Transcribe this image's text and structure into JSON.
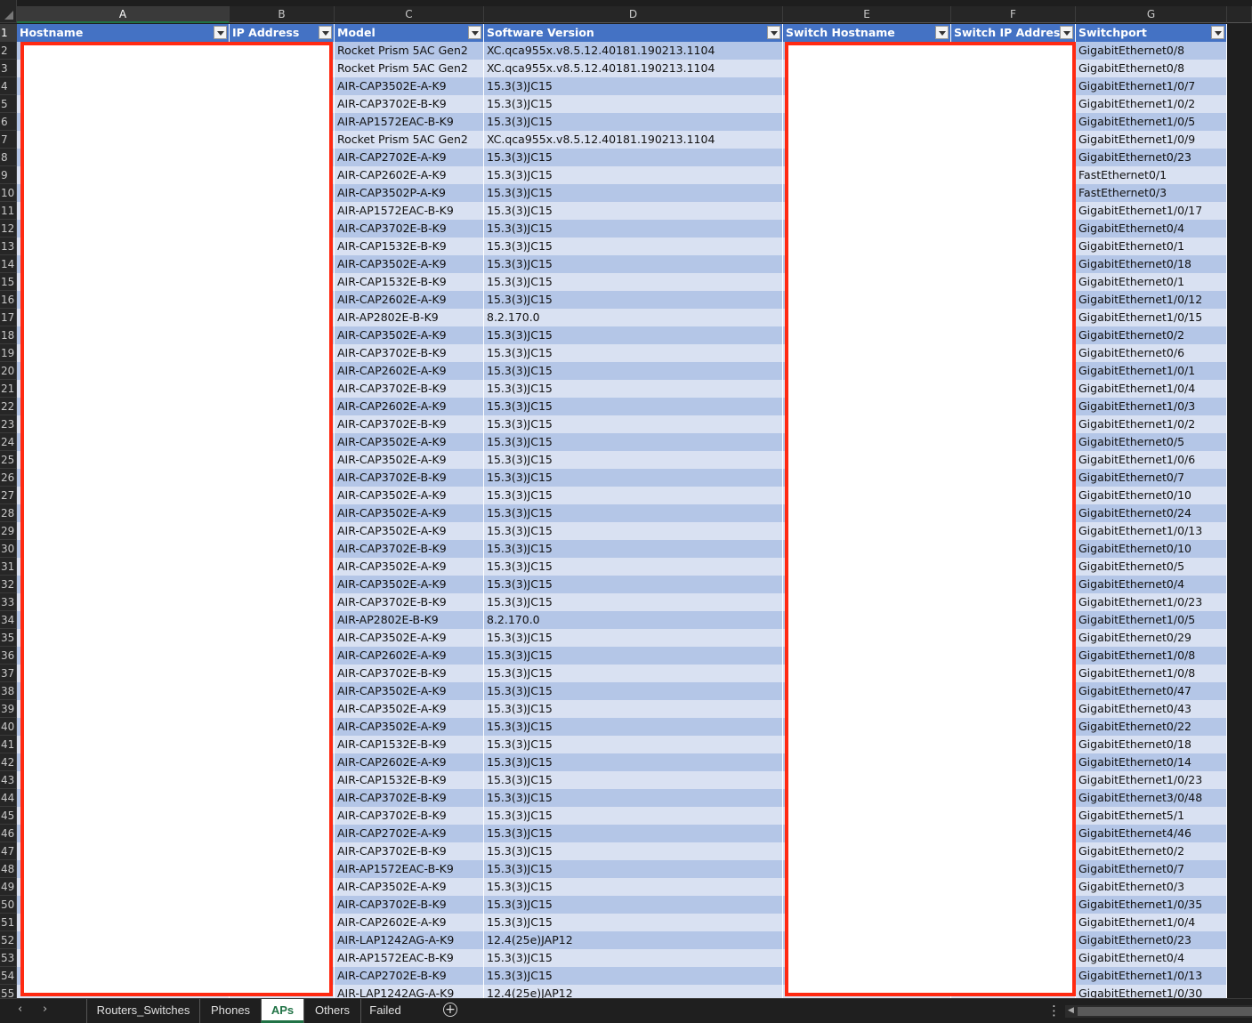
{
  "column_letters": [
    "A",
    "B",
    "C",
    "D",
    "E",
    "F",
    "G"
  ],
  "headers": [
    "Hostname",
    "IP Address",
    "Model",
    "Software Version",
    "Switch Hostname",
    "Switch IP Address",
    "Switchport"
  ],
  "row_numbers": [
    1,
    2,
    3,
    4,
    5,
    6,
    7,
    8,
    9,
    10,
    11,
    12,
    13,
    14,
    15,
    16,
    17,
    18,
    19,
    20,
    21,
    22,
    23,
    24,
    25,
    26,
    27,
    28,
    29,
    30,
    31,
    32,
    33,
    34,
    35,
    36,
    37,
    38,
    39,
    40,
    41,
    42,
    43,
    44,
    45,
    46,
    47,
    48,
    49,
    50,
    51,
    52,
    53,
    54,
    55
  ],
  "rows": [
    {
      "model": "Rocket Prism 5AC Gen2",
      "version": "XC.qca955x.v8.5.12.40181.190213.1104",
      "port": "GigabitEthernet0/8"
    },
    {
      "model": "Rocket Prism 5AC Gen2",
      "version": "XC.qca955x.v8.5.12.40181.190213.1104",
      "port": "GigabitEthernet0/8"
    },
    {
      "model": "AIR-CAP3502E-A-K9",
      "version": "15.3(3)JC15",
      "port": "GigabitEthernet1/0/7"
    },
    {
      "model": "AIR-CAP3702E-B-K9",
      "version": "15.3(3)JC15",
      "port": "GigabitEthernet1/0/2"
    },
    {
      "model": "AIR-AP1572EAC-B-K9",
      "version": "15.3(3)JC15",
      "port": "GigabitEthernet1/0/5"
    },
    {
      "model": "Rocket Prism 5AC Gen2",
      "version": "XC.qca955x.v8.5.12.40181.190213.1104",
      "port": "GigabitEthernet1/0/9"
    },
    {
      "model": "AIR-CAP2702E-A-K9",
      "version": "15.3(3)JC15",
      "port": "GigabitEthernet0/23"
    },
    {
      "model": "AIR-CAP2602E-A-K9",
      "version": "15.3(3)JC15",
      "port": "FastEthernet0/1"
    },
    {
      "model": "AIR-CAP3502P-A-K9",
      "version": "15.3(3)JC15",
      "port": "FastEthernet0/3"
    },
    {
      "model": "AIR-AP1572EAC-B-K9",
      "version": "15.3(3)JC15",
      "port": "GigabitEthernet1/0/17"
    },
    {
      "model": "AIR-CAP3702E-B-K9",
      "version": "15.3(3)JC15",
      "port": "GigabitEthernet0/4"
    },
    {
      "model": "AIR-CAP1532E-B-K9",
      "version": "15.3(3)JC15",
      "port": "GigabitEthernet0/1"
    },
    {
      "model": "AIR-CAP3502E-A-K9",
      "version": "15.3(3)JC15",
      "port": "GigabitEthernet0/18"
    },
    {
      "model": "AIR-CAP1532E-B-K9",
      "version": "15.3(3)JC15",
      "port": "GigabitEthernet0/1"
    },
    {
      "model": "AIR-CAP2602E-A-K9",
      "version": "15.3(3)JC15",
      "port": "GigabitEthernet1/0/12"
    },
    {
      "model": "AIR-AP2802E-B-K9",
      "version": "8.2.170.0",
      "port": "GigabitEthernet1/0/15"
    },
    {
      "model": "AIR-CAP3502E-A-K9",
      "version": "15.3(3)JC15",
      "port": "GigabitEthernet0/2"
    },
    {
      "model": "AIR-CAP3702E-B-K9",
      "version": "15.3(3)JC15",
      "port": "GigabitEthernet0/6"
    },
    {
      "model": "AIR-CAP2602E-A-K9",
      "version": "15.3(3)JC15",
      "port": "GigabitEthernet1/0/1"
    },
    {
      "model": "AIR-CAP3702E-B-K9",
      "version": "15.3(3)JC15",
      "port": "GigabitEthernet1/0/4"
    },
    {
      "model": "AIR-CAP2602E-A-K9",
      "version": "15.3(3)JC15",
      "port": "GigabitEthernet1/0/3"
    },
    {
      "model": "AIR-CAP3702E-B-K9",
      "version": "15.3(3)JC15",
      "port": "GigabitEthernet1/0/2"
    },
    {
      "model": "AIR-CAP3502E-A-K9",
      "version": "15.3(3)JC15",
      "port": "GigabitEthernet0/5"
    },
    {
      "model": "AIR-CAP3502E-A-K9",
      "version": "15.3(3)JC15",
      "port": "GigabitEthernet1/0/6"
    },
    {
      "model": "AIR-CAP3702E-B-K9",
      "version": "15.3(3)JC15",
      "port": "GigabitEthernet0/7"
    },
    {
      "model": "AIR-CAP3502E-A-K9",
      "version": "15.3(3)JC15",
      "port": "GigabitEthernet0/10"
    },
    {
      "model": "AIR-CAP3502E-A-K9",
      "version": "15.3(3)JC15",
      "port": "GigabitEthernet0/24"
    },
    {
      "model": "AIR-CAP3502E-A-K9",
      "version": "15.3(3)JC15",
      "port": "GigabitEthernet1/0/13"
    },
    {
      "model": "AIR-CAP3702E-B-K9",
      "version": "15.3(3)JC15",
      "port": "GigabitEthernet0/10"
    },
    {
      "model": "AIR-CAP3502E-A-K9",
      "version": "15.3(3)JC15",
      "port": "GigabitEthernet0/5"
    },
    {
      "model": "AIR-CAP3502E-A-K9",
      "version": "15.3(3)JC15",
      "port": "GigabitEthernet0/4"
    },
    {
      "model": "AIR-CAP3702E-B-K9",
      "version": "15.3(3)JC15",
      "port": "GigabitEthernet1/0/23"
    },
    {
      "model": "AIR-AP2802E-B-K9",
      "version": "8.2.170.0",
      "port": "GigabitEthernet1/0/5"
    },
    {
      "model": "AIR-CAP3502E-A-K9",
      "version": "15.3(3)JC15",
      "port": "GigabitEthernet0/29"
    },
    {
      "model": "AIR-CAP2602E-A-K9",
      "version": "15.3(3)JC15",
      "port": "GigabitEthernet1/0/8"
    },
    {
      "model": "AIR-CAP3702E-B-K9",
      "version": "15.3(3)JC15",
      "port": "GigabitEthernet1/0/8"
    },
    {
      "model": "AIR-CAP3502E-A-K9",
      "version": "15.3(3)JC15",
      "port": "GigabitEthernet0/47"
    },
    {
      "model": "AIR-CAP3502E-A-K9",
      "version": "15.3(3)JC15",
      "port": "GigabitEthernet0/43"
    },
    {
      "model": "AIR-CAP3502E-A-K9",
      "version": "15.3(3)JC15",
      "port": "GigabitEthernet0/22"
    },
    {
      "model": "AIR-CAP1532E-B-K9",
      "version": "15.3(3)JC15",
      "port": "GigabitEthernet0/18"
    },
    {
      "model": "AIR-CAP2602E-A-K9",
      "version": "15.3(3)JC15",
      "port": "GigabitEthernet0/14"
    },
    {
      "model": "AIR-CAP1532E-B-K9",
      "version": "15.3(3)JC15",
      "port": "GigabitEthernet1/0/23"
    },
    {
      "model": "AIR-CAP3702E-B-K9",
      "version": "15.3(3)JC15",
      "port": "GigabitEthernet3/0/48"
    },
    {
      "model": "AIR-CAP3702E-B-K9",
      "version": "15.3(3)JC15",
      "port": "GigabitEthernet5/1"
    },
    {
      "model": "AIR-CAP2702E-A-K9",
      "version": "15.3(3)JC15",
      "port": "GigabitEthernet4/46"
    },
    {
      "model": "AIR-CAP3702E-B-K9",
      "version": "15.3(3)JC15",
      "port": "GigabitEthernet0/2"
    },
    {
      "model": "AIR-AP1572EAC-B-K9",
      "version": "15.3(3)JC15",
      "port": "GigabitEthernet0/7"
    },
    {
      "model": "AIR-CAP3502E-A-K9",
      "version": "15.3(3)JC15",
      "port": "GigabitEthernet0/3"
    },
    {
      "model": "AIR-CAP3702E-B-K9",
      "version": "15.3(3)JC15",
      "port": "GigabitEthernet1/0/35"
    },
    {
      "model": "AIR-CAP2602E-A-K9",
      "version": "15.3(3)JC15",
      "port": "GigabitEthernet1/0/4"
    },
    {
      "model": "AIR-LAP1242AG-A-K9",
      "version": "12.4(25e)JAP12",
      "port": "GigabitEthernet0/23"
    },
    {
      "model": "AIR-AP1572EAC-B-K9",
      "version": "15.3(3)JC15",
      "port": "GigabitEthernet0/4"
    },
    {
      "model": "AIR-CAP2702E-B-K9",
      "version": "15.3(3)JC15",
      "port": "GigabitEthernet1/0/13"
    },
    {
      "model": "AIR-LAP1242AG-A-K9",
      "version": "12.4(25e)JAP12",
      "port": "GigabitEthernet1/0/30"
    }
  ],
  "sheet_tabs": [
    {
      "label": "Routers_Switches",
      "active": false
    },
    {
      "label": "Phones",
      "active": false
    },
    {
      "label": "APs",
      "active": true
    },
    {
      "label": "Others",
      "active": false
    },
    {
      "label": "Failed",
      "active": false
    }
  ],
  "icons": {
    "nav_prev": "chevron-left-icon",
    "nav_next": "chevron-right-icon",
    "add_sheet": "plus-circle-icon",
    "more": "kebab-icon"
  },
  "colors": {
    "header_blue": "#4472c4",
    "band_dark": "#b4c6e7",
    "band_light": "#d9e1f2",
    "redaction_border": "#ff2a12",
    "active_tab_green": "#217346"
  }
}
